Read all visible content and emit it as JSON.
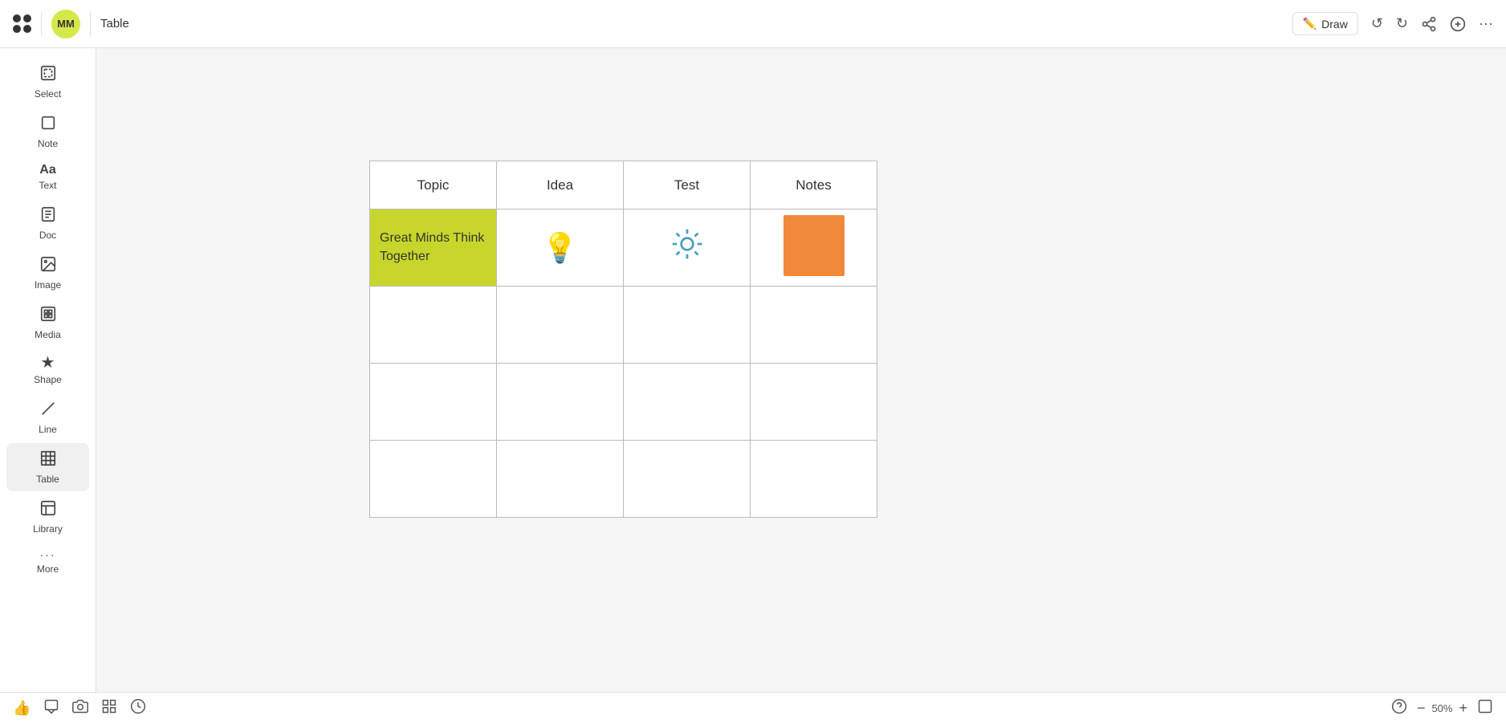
{
  "header": {
    "title": "Table",
    "avatar_initials": "MM",
    "draw_label": "Draw",
    "undo_title": "Undo",
    "redo_title": "Redo",
    "share_title": "Share",
    "publish_title": "Publish",
    "more_title": "More"
  },
  "sidebar": {
    "items": [
      {
        "id": "select",
        "label": "Select",
        "icon": "⊡"
      },
      {
        "id": "note",
        "label": "Note",
        "icon": "□"
      },
      {
        "id": "text",
        "label": "Text",
        "icon": "Aa"
      },
      {
        "id": "doc",
        "label": "Doc",
        "icon": "≡"
      },
      {
        "id": "image",
        "label": "Image",
        "icon": "🖼"
      },
      {
        "id": "media",
        "label": "Media",
        "icon": "⊞"
      },
      {
        "id": "shape",
        "label": "Shape",
        "icon": "★"
      },
      {
        "id": "line",
        "label": "Line",
        "icon": "╱"
      },
      {
        "id": "table",
        "label": "Table",
        "icon": "⊞"
      },
      {
        "id": "library",
        "label": "Library",
        "icon": "⊟"
      },
      {
        "id": "more",
        "label": "More",
        "icon": "···"
      }
    ]
  },
  "table": {
    "headers": [
      "Topic",
      "Idea",
      "Test",
      "Notes"
    ],
    "topic_cell_text": "Great Minds Think Together",
    "rows": 4
  },
  "bottom": {
    "zoom_level": "50%",
    "zoom_minus": "−",
    "zoom_plus": "+"
  }
}
